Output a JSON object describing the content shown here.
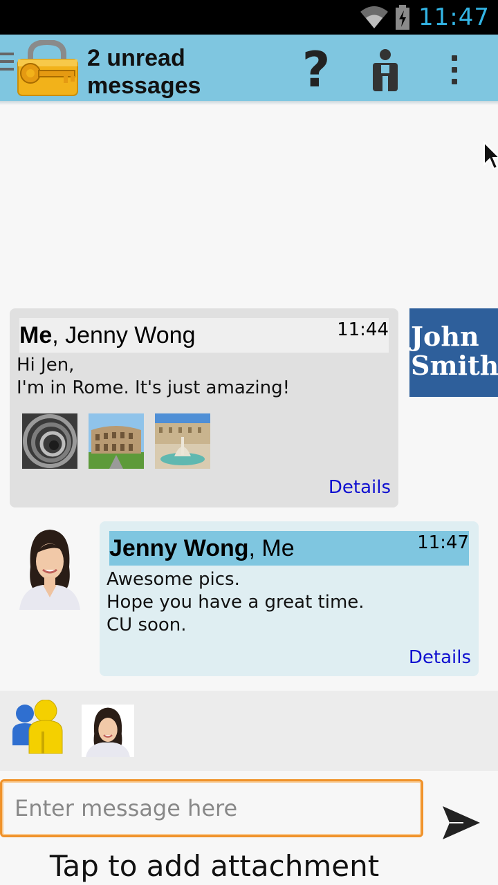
{
  "status_bar": {
    "time": "11:47",
    "icons": [
      "wifi-icon",
      "battery-charging-icon"
    ]
  },
  "action_bar": {
    "title": "2 unread messages",
    "icons": {
      "drawer": "drawer-icon",
      "logo": "padlock-key-icon",
      "help": "?",
      "contact": "contact-icon",
      "overflow": "overflow-icon"
    },
    "background": "#7fc6e0"
  },
  "messages": [
    {
      "sender_bold": "Me",
      "recipients": ", Jenny Wong",
      "time": "11:44",
      "body": [
        "Hi Jen,",
        "I'm in Rome. It's just amazing!"
      ],
      "attachments": [
        "vatican-spiral-stairs-photo",
        "colosseum-photo",
        "piazza-navona-fountain-photo"
      ],
      "details_label": "Details",
      "avatar": {
        "line1": "John",
        "line2": "Smith",
        "color": "#2e5f9b"
      }
    },
    {
      "sender_bold": "Jenny Wong",
      "recipients": ", Me",
      "time": "11:47",
      "body": [
        "Awesome pics.",
        "Hope you have a great time.",
        "CU soon."
      ],
      "details_label": "Details",
      "avatar": "jenny-wong-photo"
    }
  ],
  "participants": [
    "group-icon",
    "jenny-wong-photo"
  ],
  "composer": {
    "placeholder": "Enter message here",
    "value": "",
    "send_icon": "send-icon",
    "attachment_label": "Tap to add attachment"
  },
  "colors": {
    "accent": "#7fc6e0",
    "link": "#1010d0",
    "input_border": "#f0922a",
    "status_clock": "#33b5e5"
  }
}
